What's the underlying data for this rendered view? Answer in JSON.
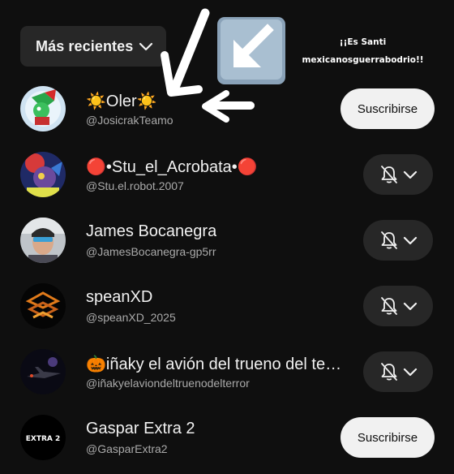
{
  "sort": {
    "label": "Más recientes",
    "icon": "chevron-down-icon"
  },
  "overlay": {
    "line1": "¡¡Es Santi",
    "line2": "mexicanosguerrabodrio!!"
  },
  "channels": [
    {
      "name": "☀️Oler☀️",
      "handle": "@JosicrakTeamo",
      "action": "subscribe",
      "action_label": "Suscribirse"
    },
    {
      "name": "🔴•Stu_el_Acrobata•🔴",
      "handle": "@Stu.el.robot.2007",
      "action": "notifications",
      "icon": "bell-off-icon"
    },
    {
      "name": "James Bocanegra",
      "handle": "@JamesBocanegra-gp5rr",
      "action": "notifications",
      "icon": "bell-off-icon"
    },
    {
      "name": "speanXD",
      "handle": "@speanXD_2025",
      "action": "notifications",
      "icon": "bell-off-icon"
    },
    {
      "name": "🎃iñaky el avión del trueno del terror",
      "handle": "@iñakyelaviondeltruenodelterror",
      "action": "notifications",
      "icon": "bell-off-icon"
    },
    {
      "name": "Gaspar Extra 2",
      "handle": "@GasparExtra2",
      "action": "subscribe",
      "action_label": "Suscribirse",
      "avatar_text": "EXTRA 2"
    }
  ]
}
